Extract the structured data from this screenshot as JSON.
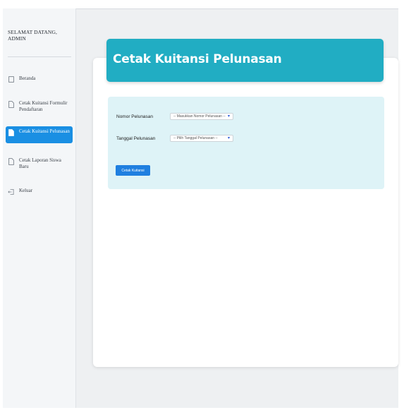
{
  "sidebar": {
    "welcome": "SELAMAT DATANG, ADMIN",
    "items": [
      {
        "label": "Beranda",
        "icon": "home-icon"
      },
      {
        "label": "Cetak Kuitansi Formulir Pendaftaran",
        "icon": "document-icon"
      },
      {
        "label": "Cetak Kuitansi Pelunasan",
        "icon": "document-icon",
        "active": true
      },
      {
        "label": "Cetak Laporan Siswa Baru",
        "icon": "document-icon"
      },
      {
        "label": "Keluar",
        "icon": "logout-icon"
      }
    ]
  },
  "header": {
    "title": "Cetak Kuitansi Pelunasan"
  },
  "form": {
    "nomor_label": "Nomor Pelunasan",
    "nomor_value": "-- Masukkan Nomor Pelunasan --",
    "tanggal_label": "Tanggal Pelunasan",
    "tanggal_value": "-- Pilih Tanggal Pelunasan --",
    "submit_label": "Cetak Kuitansi"
  },
  "colors": {
    "accent": "#21adc3",
    "active_nav": "#1a8fe3",
    "panel": "#def3f7",
    "button": "#1f7fe0"
  }
}
